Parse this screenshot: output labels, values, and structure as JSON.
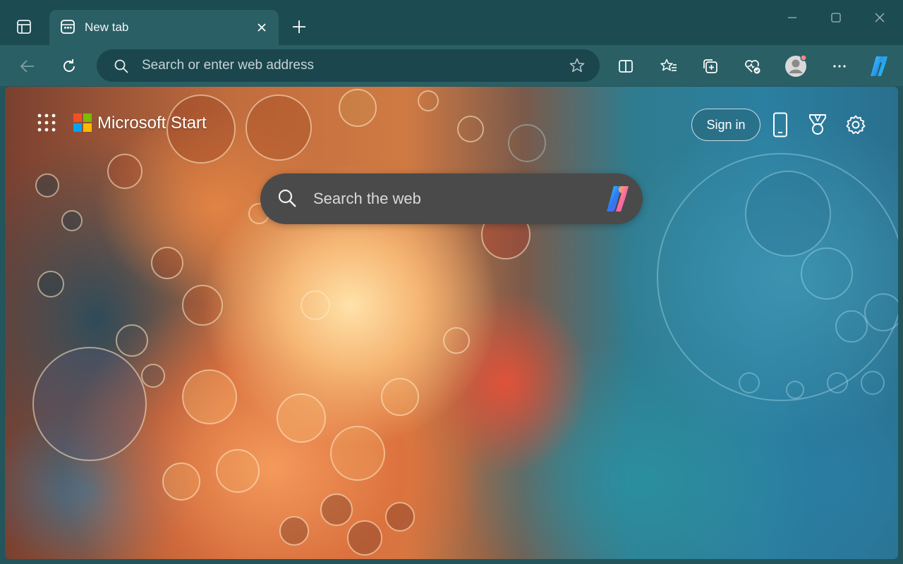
{
  "browser": {
    "tab": {
      "title": "New tab",
      "favicon": "new-tab-page-icon"
    },
    "new_tab_icon": "plus-icon",
    "window_controls": [
      "minimize-icon",
      "maximize-icon",
      "close-icon"
    ]
  },
  "toolbar": {
    "address_placeholder": "Search or enter web address",
    "address_value": "",
    "icons": [
      "back-arrow-icon",
      "refresh-icon",
      "search-icon",
      "star-icon",
      "split-screen-icon",
      "favorites-icon",
      "collections-icon",
      "browser-essentials-icon",
      "profile-avatar",
      "more-icon",
      "copilot-icon"
    ]
  },
  "start_page": {
    "brand": "Microsoft Start",
    "sign_in_label": "Sign in",
    "search_placeholder": "Search the web",
    "icons": [
      "apps-grid-icon",
      "microsoft-logo",
      "phone-icon",
      "rewards-trophy-icon",
      "settings-gear-icon",
      "copilot-icon"
    ]
  },
  "colors": {
    "tab_strip": "#1c4b52",
    "toolbar": "#2a5f66",
    "address_bar": "#1b464d",
    "search_box": "#4a4a4a"
  }
}
